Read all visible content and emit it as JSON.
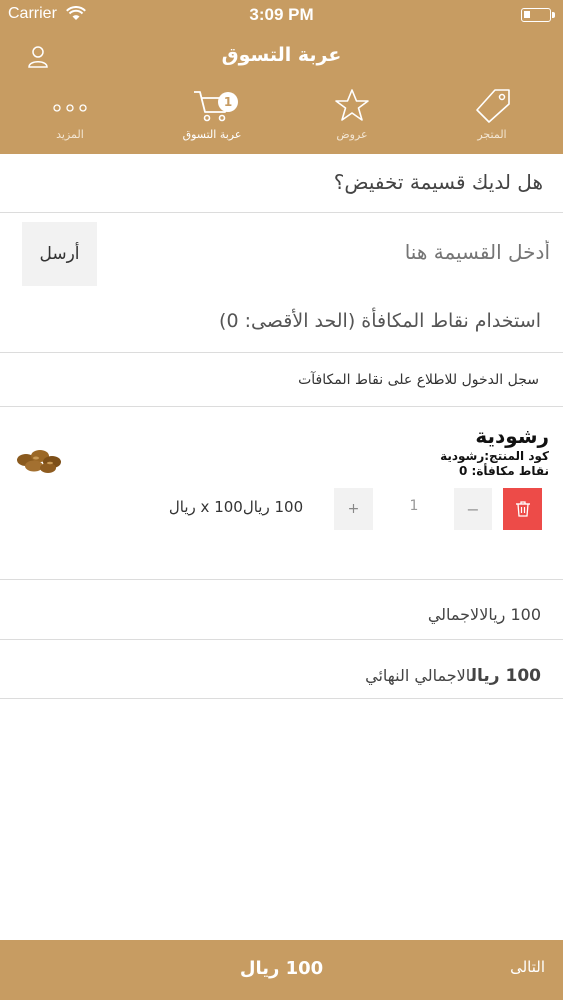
{
  "status_bar": {
    "carrier": "Carrier",
    "time": "3:09 PM"
  },
  "nav": {
    "title": "عربة التسوق"
  },
  "tabs": [
    {
      "label": "المتجر",
      "icon": "tag-icon"
    },
    {
      "label": "عروض",
      "icon": "star-icon"
    },
    {
      "label": "عربة التسوق",
      "icon": "cart-icon",
      "badge": "1",
      "active": true
    },
    {
      "label": "المزيد",
      "icon": "more-icon"
    }
  ],
  "coupon": {
    "question": "هل لديك قسيمة تخفيض؟",
    "placeholder": "أدخل القسيمة هنا",
    "send_label": "أرسل"
  },
  "reward": {
    "use_label": "استخدام نقاط المكافأة (الحد الأقصى: 0)",
    "login_label": "سجل الدخول للاطلاع على نقاط المكافآت"
  },
  "cart_item": {
    "name": "رشودية",
    "code": "كود المنتج:رشودية",
    "points": "نقاط مكافأة: 0",
    "quantity": "1",
    "line_price": "100 ريال100 x ريال",
    "minus": "−",
    "plus": "+"
  },
  "totals": {
    "total_amount": "100 ريال",
    "total_label": "الاجمالي",
    "final_amount": "100 ريال",
    "final_label": "الاجمالي النهائي"
  },
  "bottom_bar": {
    "total": "100 ريال",
    "next_label": "التالى"
  },
  "colors": {
    "brand": "#c79c62",
    "delete": "#ed4b48"
  }
}
